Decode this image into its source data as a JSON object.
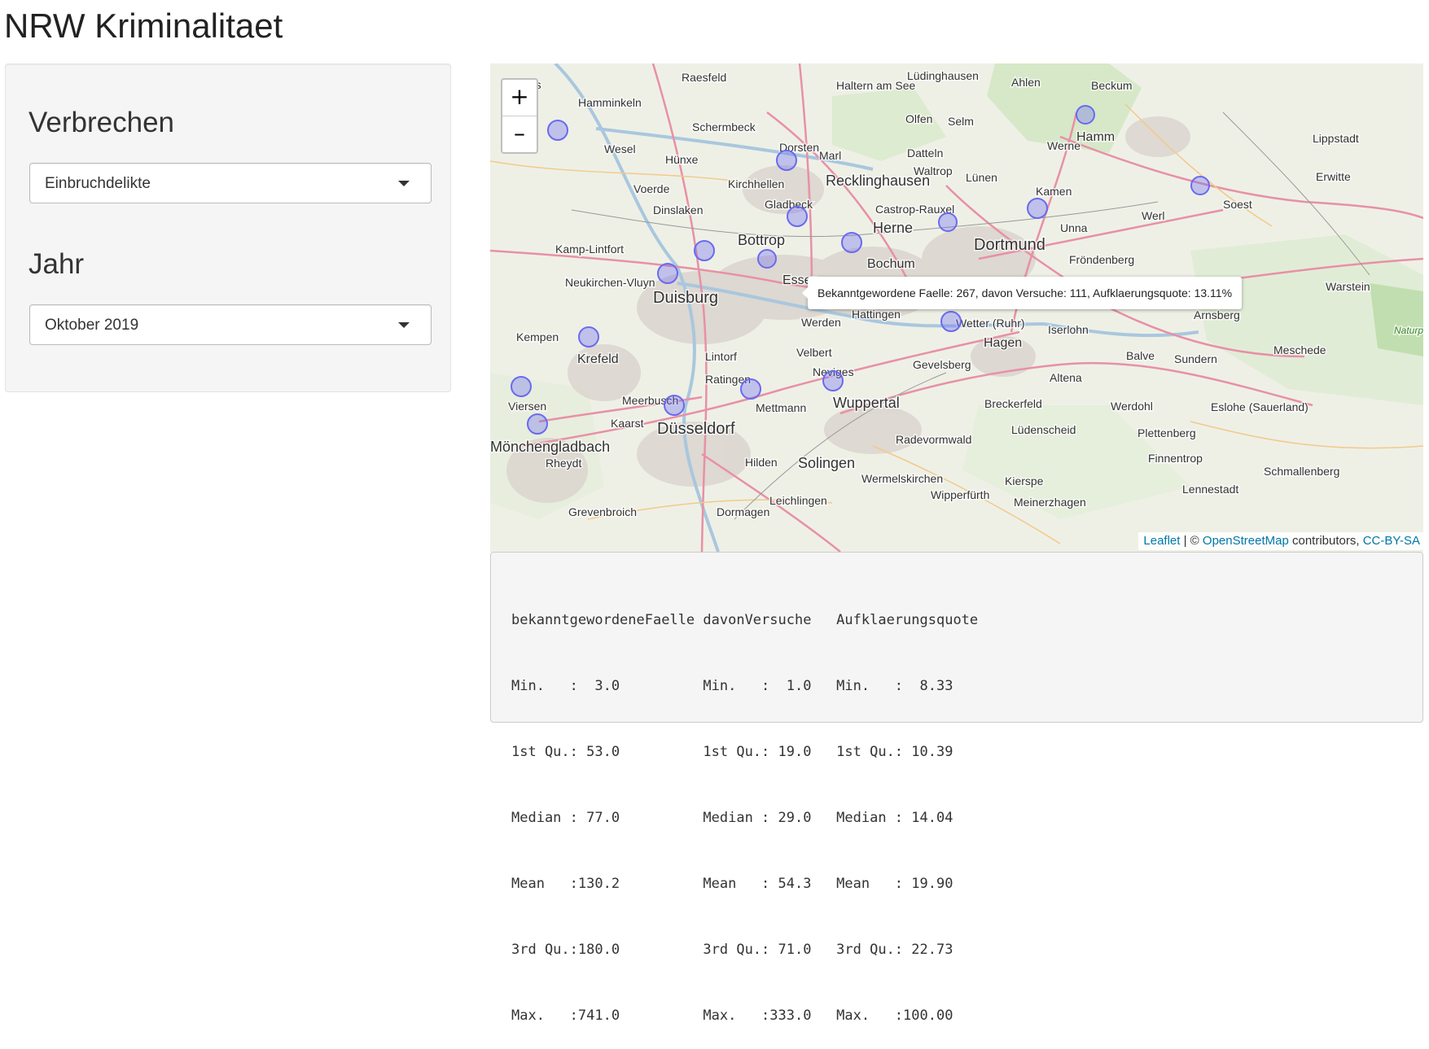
{
  "page": {
    "title": "NRW Kriminalitaet"
  },
  "sidebar": {
    "crime_label": "Verbrechen",
    "crime_value": "Einbruchdelikte",
    "year_label": "Jahr",
    "year_value": "Oktober 2019"
  },
  "map": {
    "zoom_in": "+",
    "zoom_out": "–",
    "tooltip": "Bekanntgewordene Faelle: 267, davon Versuche: 111, Aufklaerungsquote: 13.11%",
    "attribution": {
      "leaflet": "Leaflet",
      "sep1": " | © ",
      "osm": "OpenStreetMap",
      "mid": " contributors, ",
      "license": "CC-BY-SA"
    },
    "marker_color": "#6a6af0",
    "places": [
      "Raesfeld",
      "Haltern am See",
      "Lüdinghausen",
      "Ahlen",
      "Beckum",
      "Rees",
      "Hamminkeln",
      "Schermbeck",
      "Olfen",
      "Selm",
      "Hamm",
      "Lippstadt",
      "Wesel",
      "Hünxe",
      "Dorsten",
      "Marl",
      "Datteln",
      "Werne",
      "Voerde",
      "Kirchhellen",
      "Recklinghausen",
      "Waltrop",
      "Lünen",
      "Kamen",
      "Erwitte",
      "Dinslaken",
      "Gladbeck",
      "Castrop-Rauxel",
      "Werl",
      "Soest",
      "Bottrop",
      "Herne",
      "Dortmund",
      "Unna",
      "Kamp-Lintfort",
      "Bochum",
      "Fröndenberg",
      "Neukirchen-Vluyn",
      "Duisburg",
      "Essen",
      "Warstein",
      "Hattingen",
      "Wetter (Ruhr)",
      "Iserlohn",
      "Arnsberg",
      "Kempen",
      "Werden",
      "Hagen",
      "Balve",
      "Sundern",
      "Meschede",
      "Krefeld",
      "Lintorf",
      "Velbert",
      "Gevelsberg",
      "Altena",
      "Ratingen",
      "Neviges",
      "Viersen",
      "Meerbusch",
      "Mettmann",
      "Wuppertal",
      "Breckerfeld",
      "Werdohl",
      "Eslohe (Sauerland)",
      "Kaarst",
      "Düsseldorf",
      "Lüdenscheid",
      "Plettenberg",
      "Radevormwald",
      "Mönchengladbach",
      "Rheydt",
      "Hilden",
      "Solingen",
      "Finnentrop",
      "Schmallenberg",
      "Wermelskirchen",
      "Kierspe",
      "Wipperfürth",
      "Lennestadt",
      "Meinerzhagen",
      "Leichlingen",
      "Dormagen",
      "Grevenbroich",
      "Naturpark Arnsberger Wald"
    ]
  },
  "summary": {
    "lines": [
      "bekanntgewordeneFaelle davonVersuche   Aufklaerungsquote",
      "Min.   :  3.0          Min.   :  1.0   Min.   :  8.33   ",
      "1st Qu.: 53.0          1st Qu.: 19.0   1st Qu.: 10.39   ",
      "Median : 77.0          Median : 29.0   Median : 14.04   ",
      "Mean   :130.2          Mean   : 54.3   Mean   : 19.90   ",
      "3rd Qu.:180.0          3rd Qu.: 71.0   3rd Qu.: 22.73   ",
      "Max.   :741.0          Max.   :333.0   Max.   :100.00   "
    ]
  }
}
